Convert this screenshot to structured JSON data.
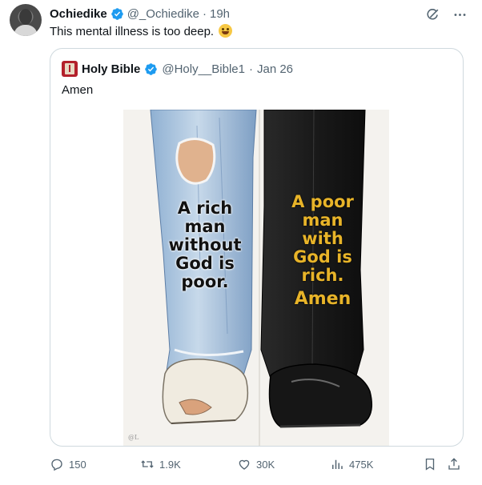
{
  "tweet": {
    "author_name": "Ochiedike",
    "handle": "@_Ochiedike",
    "separator": "·",
    "time": "19h",
    "text": "This mental illness is too deep.",
    "emoji": "rolling-on-floor-laughing"
  },
  "quoted": {
    "author_name": "Holy Bible",
    "handle": "@Holy__Bible1",
    "separator": "·",
    "date": "Jan 26",
    "text": "Amen",
    "image": {
      "left_caption_lines": [
        "A rich",
        "man",
        "without",
        "God is",
        "poor."
      ],
      "right_caption_lines": [
        "A poor",
        "man",
        "with",
        "God is",
        "rich."
      ],
      "right_caption_amen": "Amen",
      "watermark": "@L"
    }
  },
  "stats": {
    "replies": "150",
    "reposts": "1.9K",
    "likes": "30K",
    "views": "475K"
  },
  "colors": {
    "verified_blue": "#1d9bf0",
    "muted_text": "#536471",
    "caption_gold": "#e8b429"
  },
  "icons": [
    "verified-badge-icon",
    "grok-icon",
    "more-icon",
    "reply-icon",
    "repost-icon",
    "like-icon",
    "views-icon",
    "bookmark-icon",
    "share-icon"
  ]
}
